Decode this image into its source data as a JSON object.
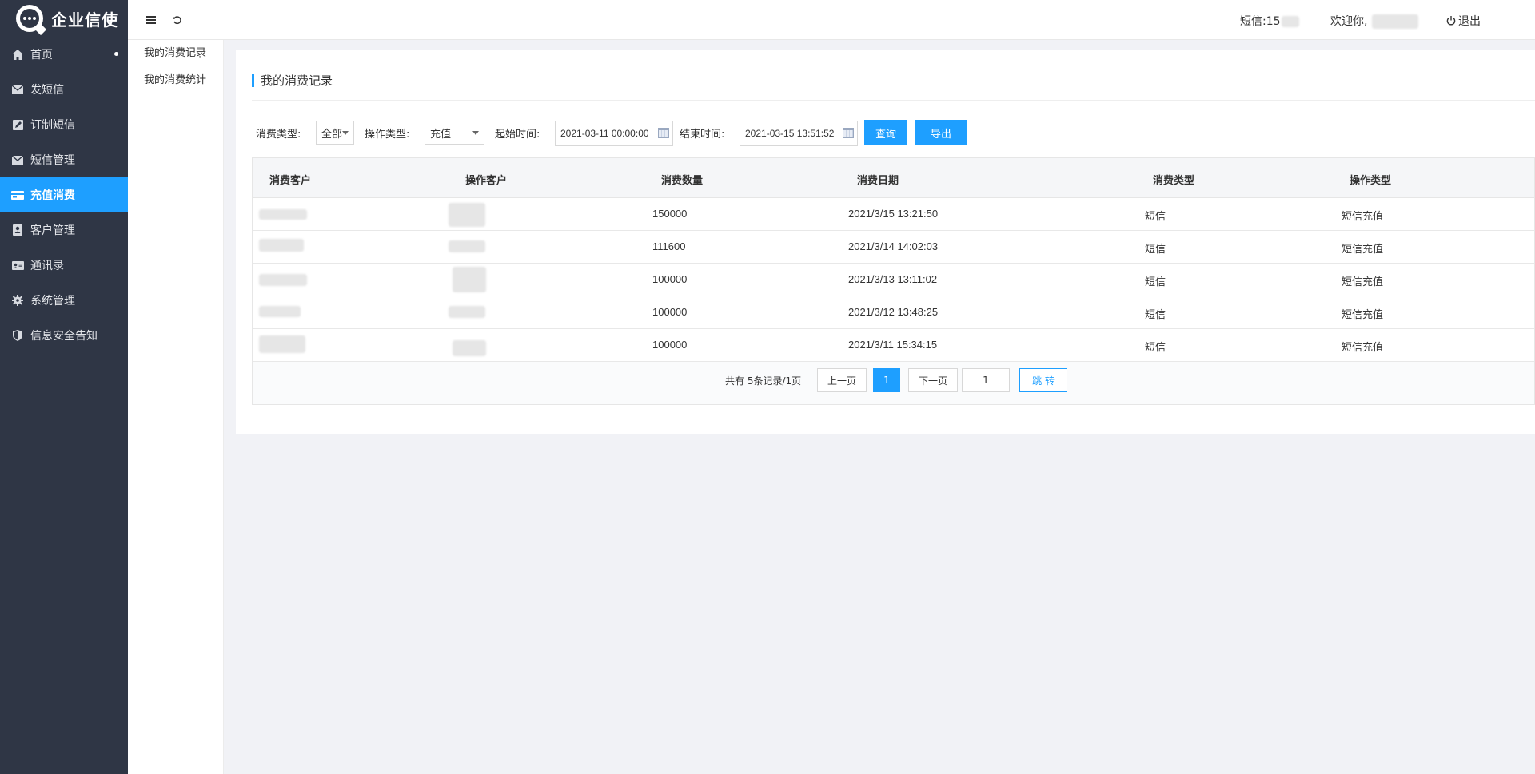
{
  "app": {
    "name": "企业信使"
  },
  "colors": {
    "accent": "#1e9fff",
    "sidebar_bg": "#2f3645"
  },
  "sidebar": {
    "items": [
      {
        "label": "首页",
        "icon": "home-icon"
      },
      {
        "label": "发短信",
        "icon": "envelope-icon"
      },
      {
        "label": "订制短信",
        "icon": "edit-icon"
      },
      {
        "label": "短信管理",
        "icon": "envelope-icon"
      },
      {
        "label": "充值消费",
        "icon": "credit-card-icon"
      },
      {
        "label": "客户管理",
        "icon": "contact-book-icon"
      },
      {
        "label": "通讯录",
        "icon": "address-card-icon"
      },
      {
        "label": "系统管理",
        "icon": "gear-icon"
      },
      {
        "label": "信息安全告知",
        "icon": "shield-icon"
      }
    ]
  },
  "topbar": {
    "sms_label": "短信:15",
    "welcome": "欢迎你,",
    "logout": "退出"
  },
  "subnav": {
    "items": [
      "我的消费记录",
      "我的消费统计"
    ]
  },
  "panel": {
    "title": "我的消费记录"
  },
  "filters": {
    "consume_type_label": "消费类型:",
    "consume_type_value": "全部",
    "op_type_label": "操作类型:",
    "op_type_value": "充值",
    "start_label": "起始时间:",
    "start_value": "2021-03-11 00:00:00",
    "end_label": "结束时间:",
    "end_value": "2021-03-15 13:51:52",
    "query_label": "查询",
    "export_label": "导出"
  },
  "table": {
    "columns": [
      "消费客户",
      "操作客户",
      "消费数量",
      "消费日期",
      "消费类型",
      "操作类型"
    ],
    "rows": [
      {
        "qty": "150000",
        "date": "2021/3/15 13:21:50",
        "ctype": "短信",
        "otype": "短信充值"
      },
      {
        "qty": "111600",
        "date": "2021/3/14 14:02:03",
        "ctype": "短信",
        "otype": "短信充值"
      },
      {
        "qty": "100000",
        "date": "2021/3/13 13:11:02",
        "ctype": "短信",
        "otype": "短信充值"
      },
      {
        "qty": "100000",
        "date": "2021/3/12 13:48:25",
        "ctype": "短信",
        "otype": "短信充值"
      },
      {
        "qty": "100000",
        "date": "2021/3/11 15:34:15",
        "ctype": "短信",
        "otype": "短信充值"
      }
    ]
  },
  "pagination": {
    "summary": "共有 5条记录/1页",
    "prev": "上一页",
    "current": "1",
    "next": "下一页",
    "page_input": "1",
    "go": "跳 转"
  }
}
